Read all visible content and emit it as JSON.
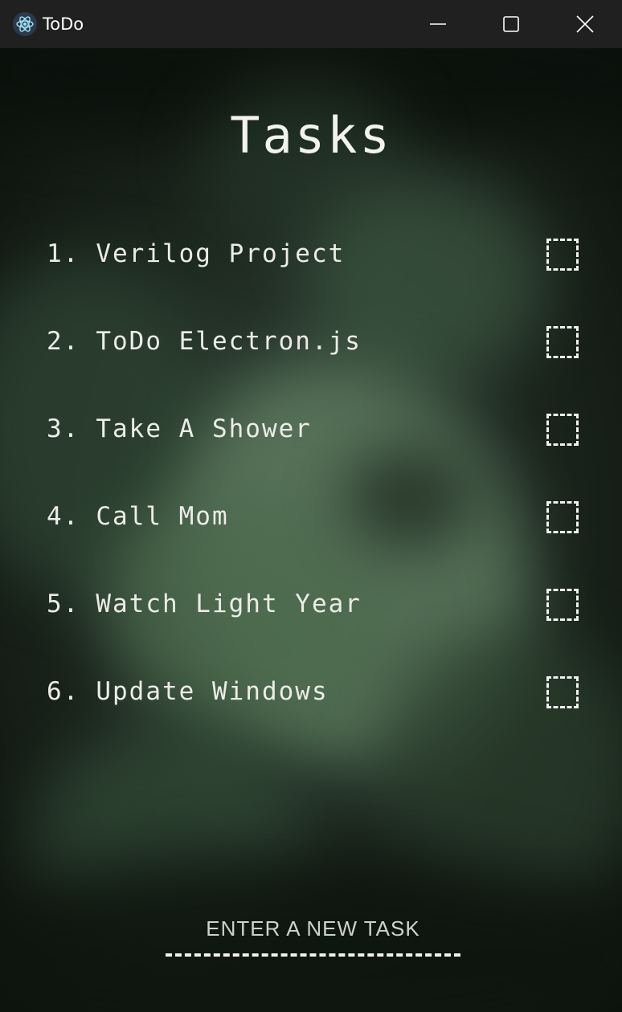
{
  "window": {
    "title": "ToDo",
    "icon": "electron-atom-icon",
    "controls": {
      "minimize": "minimize-icon",
      "maximize": "maximize-icon",
      "close": "close-icon"
    }
  },
  "main": {
    "heading": "Tasks",
    "tasks": [
      {
        "number": "1.",
        "label": "Verilog Project",
        "checked": false
      },
      {
        "number": "2.",
        "label": "ToDo Electron.js",
        "checked": false
      },
      {
        "number": "3.",
        "label": "Take A Shower",
        "checked": false
      },
      {
        "number": "4.",
        "label": "Call Mom",
        "checked": false
      },
      {
        "number": "5.",
        "label": "Watch Light Year",
        "checked": false
      },
      {
        "number": "6.",
        "label": "Update Windows",
        "checked": false
      }
    ],
    "new_task": {
      "placeholder": "ENTER A NEW TASK",
      "value": ""
    }
  },
  "colors": {
    "titlebar": "#202020",
    "text": "#ecece6",
    "accent": "#f0f0f0"
  }
}
